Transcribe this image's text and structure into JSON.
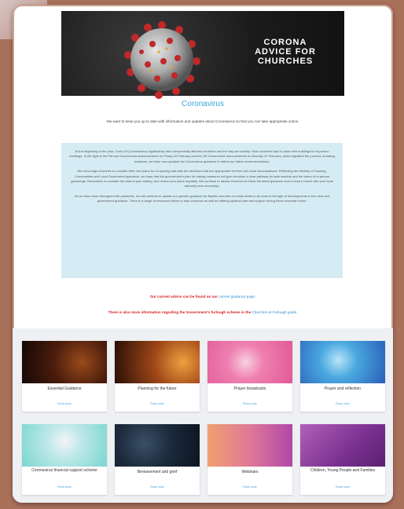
{
  "banner": {
    "title_line1": "CORONA",
    "title_line2": "ADVICE FOR",
    "title_line3": "CHURCHES"
  },
  "page_title": "Coronavirus",
  "intro": "We want to keep you up to date with information and updates about Coronavirus so that you can take appropriate action.",
  "info_paragraphs": [
    "At the beginning of the year, Covid-19 (Coronavirus) significantly and unexpectedly affected churches and the way we worship. Most churches had to close their buildings for in-person meetings. In the light of the PM and Government announcement on Friday 16 February and the UK Government announcement on Monday 22 February, which signalled the process of easing lockdown, we have now updated the Coronavirus guidance to reflect our latest recommendations.",
    "We encourage churches to consider their own plans for re-opening and take the decisions that are appropriate for their own local circumstances. Reflecting the Ministry of Housing, Communities and Local Government guidance, we hope that the government's plan for easing measures will give churches a clear pathway for safe worship and the return of in-person gatherings. Remember to consider the risks in your setting, and review your plans regularly. We continue to advise churches to follow the latest guidance and to keep in touch with your local authority and community.",
    "As we have done throughout the pandemic, we will continue to update our specific guidance for Baptist churches on what needs to be done in the light of developments in the virus and government guidance. There is a range of resources below to help churches as well as offering spiritual care and support during these uncertain times."
  ],
  "notice1": {
    "text": "Our current advice can be found on our ",
    "link": "current guidance page."
  },
  "notice2": {
    "text": "There is also more information regarding the Government's furlough scheme in the ",
    "link": "Churches at Furlough guide."
  },
  "cards": [
    {
      "title": "Essential Guidance",
      "link": "Read more"
    },
    {
      "title": "Planning for the future",
      "link": "Read more"
    },
    {
      "title": "Prayer broadcasts",
      "link": "Read more"
    },
    {
      "title": "Prayer and reflection",
      "link": "Read more"
    },
    {
      "title": "Coronavirus financial support scheme",
      "link": "Read more"
    },
    {
      "title": "Bereavement and grief",
      "link": "Read more"
    },
    {
      "title": "Webinars",
      "link": "Read more"
    },
    {
      "title": "Children, Young People and Families",
      "link": "Read more"
    }
  ],
  "colors": {
    "accent": "#3aa5d6",
    "notice_red": "#d42020",
    "info_bg": "#d5ecf4",
    "outer_bg": "#a9705a"
  }
}
